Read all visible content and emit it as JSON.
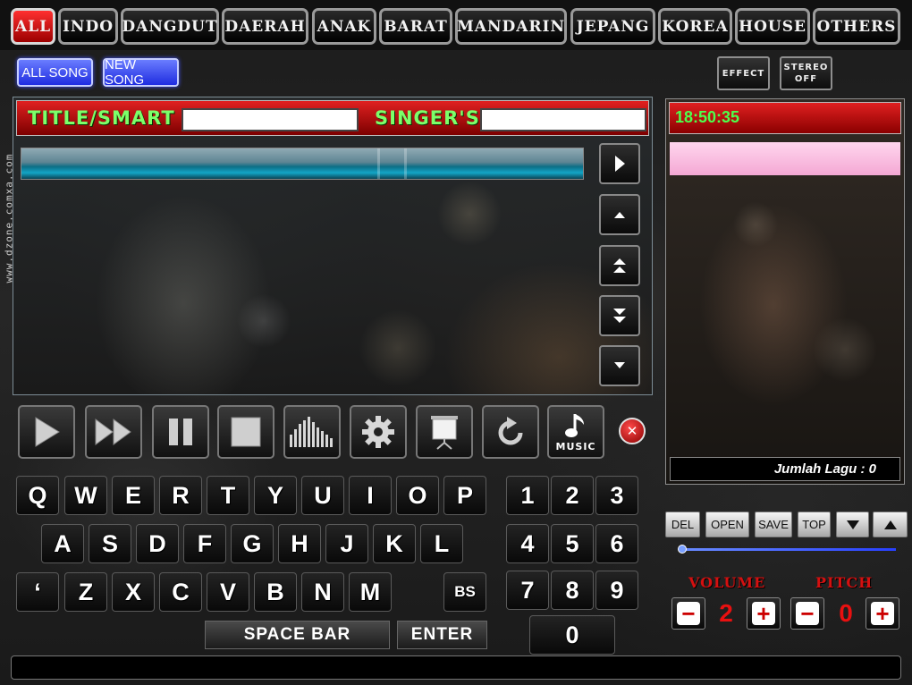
{
  "categories": [
    "ALL",
    "INDO",
    "DANGDUT",
    "DAERAH",
    "ANAK",
    "BARAT",
    "MANDARIN",
    "JEPANG",
    "KOREA",
    "HOUSE",
    "OTHERS"
  ],
  "active_category": "ALL",
  "song_filters": {
    "all_song": "ALL SONG",
    "new_song": "NEW SONG"
  },
  "effect_label": "EFFECT",
  "stereo": {
    "line1": "STEREO",
    "line2": "OFF"
  },
  "search": {
    "title_label": "TITLE/SMART",
    "singer_label": "SINGER'S",
    "title_value": "",
    "singer_value": ""
  },
  "transport": {
    "music_label": "MUSIC"
  },
  "keyboard": {
    "row1": [
      "Q",
      "W",
      "E",
      "R",
      "T",
      "Y",
      "U",
      "I",
      "O",
      "P"
    ],
    "row2": [
      "A",
      "S",
      "D",
      "F",
      "G",
      "H",
      "J",
      "K",
      "L"
    ],
    "row3": [
      "‘",
      "Z",
      "X",
      "C",
      "V",
      "B",
      "N",
      "M"
    ],
    "backspace": "BS",
    "numpad": [
      "1",
      "2",
      "3",
      "4",
      "5",
      "6",
      "7",
      "8",
      "9",
      "0"
    ],
    "space_bar": "SPACE BAR",
    "enter": "ENTER"
  },
  "right_panel": {
    "clock": "18:50:35",
    "count_text": "Jumlah Lagu : 0"
  },
  "playlist_buttons": {
    "del": "DEL",
    "open": "OPEN",
    "save": "SAVE",
    "top": "TOP"
  },
  "volume": {
    "label": "VOLUME",
    "value": "2"
  },
  "pitch": {
    "label": "PITCH",
    "value": "0"
  },
  "watermark": "www.dzone.comxa.com"
}
